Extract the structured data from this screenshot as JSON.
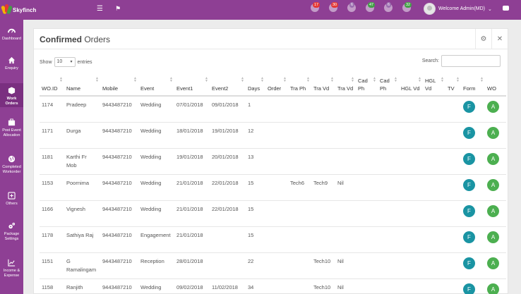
{
  "app": {
    "name": "Skyfinch"
  },
  "header": {
    "user_label": "Welcome Admin(MD)",
    "notifications": [
      {
        "count": "17",
        "color": "#e53935"
      },
      {
        "count": "30",
        "color": "#e53935"
      },
      {
        "count": "6",
        "color": "#9c6fb0"
      },
      {
        "count": "47",
        "color": "#43a047"
      },
      {
        "count": "6",
        "color": "#9c6fb0"
      },
      {
        "count": "32",
        "color": "#43a047"
      }
    ]
  },
  "sidebar": {
    "items": [
      {
        "label": "Dashboard",
        "icon": "dashboard-icon"
      },
      {
        "label": "Enquiry",
        "icon": "home-icon"
      },
      {
        "label": "Work Orders",
        "icon": "cube-icon"
      },
      {
        "label": "Post Event Allocation",
        "icon": "briefcase-icon"
      },
      {
        "label": "Completed Workorder",
        "icon": "globe-icon"
      },
      {
        "label": "Others",
        "icon": "plus-square-icon"
      },
      {
        "label": "Package Settings",
        "icon": "gears-icon"
      },
      {
        "label": "Income & Expense",
        "icon": "line-chart-icon"
      }
    ]
  },
  "panel": {
    "title_bold": "Confirmed",
    "title_rest": " Orders",
    "show_label": "Show",
    "entries_value": "10",
    "entries_label": "entries",
    "search_label": "Search:"
  },
  "table": {
    "columns": [
      "WO.ID",
      "Name",
      "Mobile",
      "Event",
      "Event1",
      "Event2",
      "Days",
      "Order",
      "Tra Ph",
      "Tra Vd",
      "Tra Vd",
      "Cad Ph",
      "Cad Ph",
      "HGL Vd",
      "HGL Vd",
      "TV",
      "Form",
      "WO"
    ],
    "rows": [
      {
        "id": "1174",
        "name": "Pradeep",
        "mobile": "9443487210",
        "event": "Wedding",
        "event1": "07/01/2018",
        "event2": "09/01/2018",
        "days": "1",
        "order": "",
        "traph": "",
        "travd": "",
        "travd2": "",
        "form": "F",
        "wo": "A"
      },
      {
        "id": "1171",
        "name": "Durga",
        "mobile": "9443487210",
        "event": "Wedding",
        "event1": "18/01/2018",
        "event2": "19/01/2018",
        "days": "12",
        "order": "",
        "traph": "",
        "travd": "",
        "travd2": "",
        "form": "F",
        "wo": "A"
      },
      {
        "id": "1181",
        "name": "Karthi Fr Mob",
        "mobile": "9443487210",
        "event": "Wedding",
        "event1": "19/01/2018",
        "event2": "20/01/2018",
        "days": "13",
        "order": "",
        "traph": "",
        "travd": "",
        "travd2": "",
        "form": "F",
        "wo": "A"
      },
      {
        "id": "1153",
        "name": "Poornima",
        "mobile": "9443487210",
        "event": "Wedding",
        "event1": "21/01/2018",
        "event2": "22/01/2018",
        "days": "15",
        "order": "",
        "traph": "Tech6",
        "travd": "Tech9",
        "travd2": "Nil",
        "form": "F",
        "wo": "A"
      },
      {
        "id": "1166",
        "name": "Vignesh",
        "mobile": "9443487210",
        "event": "Wedding",
        "event1": "21/01/2018",
        "event2": "22/01/2018",
        "days": "15",
        "order": "",
        "traph": "",
        "travd": "",
        "travd2": "",
        "form": "F",
        "wo": "A"
      },
      {
        "id": "1178",
        "name": "Sathiya Raj",
        "mobile": "9443487210",
        "event": "Engagement",
        "event1": "21/01/2018",
        "event2": "",
        "days": "15",
        "order": "",
        "traph": "",
        "travd": "",
        "travd2": "",
        "form": "F",
        "wo": "A"
      },
      {
        "id": "1151",
        "name": "G Ramalingam",
        "mobile": "9443487210",
        "event": "Reception",
        "event1": "28/01/2018",
        "event2": "",
        "days": "22",
        "order": "",
        "traph": "",
        "travd": "Tech10",
        "travd2": "Nil",
        "form": "F",
        "wo": "A"
      },
      {
        "id": "1158",
        "name": "Ranjith",
        "mobile": "9443487210",
        "event": "Wedding",
        "event1": "09/02/2018",
        "event2": "11/02/2018",
        "days": "34",
        "order": "",
        "traph": "",
        "travd": "Tech10",
        "travd2": "Nil",
        "form": "F",
        "wo": "A"
      }
    ]
  }
}
